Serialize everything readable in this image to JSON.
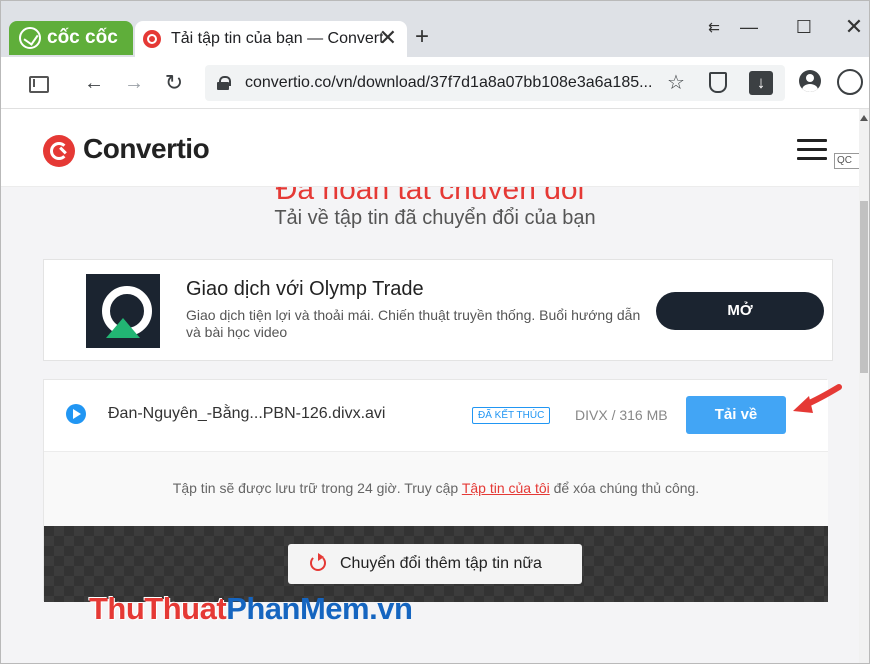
{
  "browser": {
    "brand": "cốc cốc",
    "tab_title": "Tải tập tin của bạn — Convertio",
    "url": "convertio.co/vn/download/37f7d1a8a07bb108e3a6a185...",
    "icons": [
      "coccoc-logo-icon",
      "convertio-favicon-icon",
      "close-tab-icon",
      "new-tab-icon",
      "sidebar-icon",
      "back-icon",
      "forward-icon",
      "reload-icon",
      "lock-icon",
      "star-icon",
      "shield-icon",
      "download-icon",
      "profile-icon",
      "extension-icon"
    ],
    "glyphs": {
      "close": "✕",
      "plus": "+",
      "pin": "⇇",
      "min": "—",
      "max": "☐",
      "back": "←",
      "fwd": "→",
      "reload": "↻",
      "star": "☆",
      "download": "↓"
    }
  },
  "site": {
    "name": "Convertio",
    "heading": "Đã hoàn tất chuyển đổi",
    "subheading": "Tải về tập tin đã chuyển đổi của bạn"
  },
  "ad": {
    "title": "Giao dịch với Olymp Trade",
    "description": "Giao dịch tiện lợi và thoải mái. Chiến thuật truyền thống. Buổi hướng dẫn và bài học video",
    "button": "MỞ",
    "badge": "QC"
  },
  "file": {
    "name": "Đan-Nguyên_-Bằng...PBN-126.divx.avi",
    "status": "ĐÃ KẾT THÚC",
    "info": "DIVX / 316 MB",
    "download_label": "Tải về"
  },
  "note": {
    "before": "Tập tin sẽ được lưu trữ trong 24 giờ. Truy cập ",
    "link": "Tập tin của tôi",
    "after": " để xóa chúng thủ công."
  },
  "convert_more": "Chuyển đổi thêm tập tin nữa",
  "watermark": {
    "part1": "ThuThuat",
    "part2": "PhanMem",
    "part3": ".vn"
  },
  "colors": {
    "brand_red": "#e53935",
    "accent_blue": "#42a5f5",
    "coccoc_green": "#5fae3a",
    "ad_dark": "#1b2430"
  }
}
